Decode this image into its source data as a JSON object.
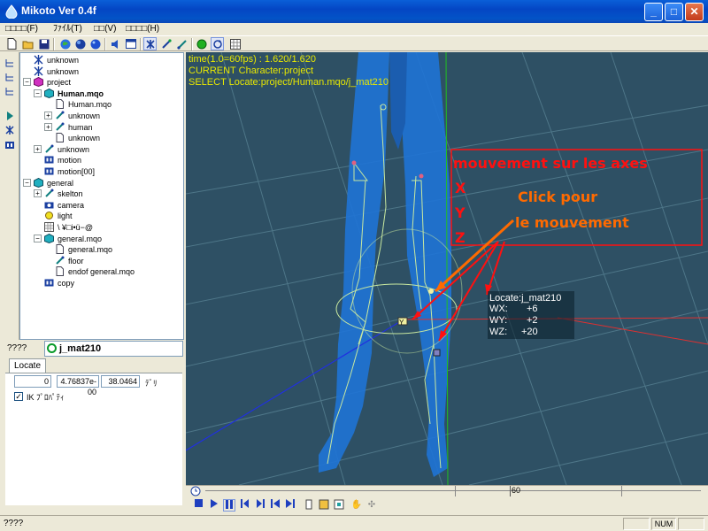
{
  "window": {
    "title": "Mikoto Ver 0.4f",
    "min": "_",
    "max": "□",
    "close": "✕"
  },
  "menu": [
    "□□□□(F)",
    "ﾌｧｲﾙ(T)",
    "□□(V)",
    "□□□□(H)"
  ],
  "toolbar": {
    "icons": [
      "new-file-icon",
      "open-folder-icon",
      "save-icon",
      "globe-icon",
      "globe-dark-icon",
      "sphere-icon",
      "speaker-icon",
      "window-icon",
      "bone-x-icon",
      "bone-blue-icon",
      "bone-teal-icon",
      "green-dot-icon",
      "refresh-icon",
      "grid-icon"
    ]
  },
  "tree": [
    {
      "label": "unknown",
      "icon": "bone-x-icon",
      "depth": 0,
      "expander": ""
    },
    {
      "label": "unknown",
      "icon": "bone-x-icon",
      "depth": 0,
      "expander": ""
    },
    {
      "label": "project",
      "icon": "cube-magenta-icon",
      "depth": 0,
      "expander": "−"
    },
    {
      "label": "Human.mqo",
      "icon": "cube-teal-icon",
      "depth": 1,
      "expander": "−",
      "bold": true
    },
    {
      "label": "Human.mqo",
      "icon": "page-icon",
      "depth": 2,
      "expander": ""
    },
    {
      "label": "unknown",
      "icon": "bone-teal-icon",
      "depth": 2,
      "expander": "+"
    },
    {
      "label": "human",
      "icon": "bone-teal-icon",
      "depth": 2,
      "expander": "+"
    },
    {
      "label": "unknown",
      "icon": "page-icon",
      "depth": 2,
      "expander": ""
    },
    {
      "label": "unknown",
      "icon": "bone-teal-icon",
      "depth": 1,
      "expander": "+"
    },
    {
      "label": "motion",
      "icon": "film-icon",
      "depth": 1,
      "expander": ""
    },
    {
      "label": "motion[00]",
      "icon": "film-icon",
      "depth": 1,
      "expander": ""
    },
    {
      "label": "general",
      "icon": "cube-teal-icon",
      "depth": 0,
      "expander": "−"
    },
    {
      "label": "skelton",
      "icon": "bone-teal-icon",
      "depth": 1,
      "expander": "+"
    },
    {
      "label": "camera",
      "icon": "camera-icon",
      "depth": 1,
      "expander": ""
    },
    {
      "label": "light",
      "icon": "light-icon",
      "depth": 1,
      "expander": ""
    },
    {
      "label": "\\ ¥□i•ü−@",
      "icon": "mesh-icon",
      "depth": 1,
      "expander": ""
    },
    {
      "label": "general.mqo",
      "icon": "cube-teal-icon",
      "depth": 1,
      "expander": "−"
    },
    {
      "label": "general.mqo",
      "icon": "page-icon",
      "depth": 2,
      "expander": ""
    },
    {
      "label": "floor",
      "icon": "bone-teal-icon",
      "depth": 2,
      "expander": ""
    },
    {
      "label": "endof general.mqo",
      "icon": "page-icon",
      "depth": 2,
      "expander": ""
    },
    {
      "label": "copy",
      "icon": "film-icon",
      "depth": 1,
      "expander": ""
    }
  ],
  "props": {
    "title": "????",
    "joint": "j_mat210",
    "tab": "Locate",
    "x": "0",
    "y": "4.76837e-00",
    "z": "38.0464",
    "unit": "ﾃﾞﾘ",
    "ik_checked": "✓",
    "ik_label": "IK ﾌﾟﾛﾊﾟﾃｨ"
  },
  "viewport": {
    "hud": [
      "time(1.0=60fps) : 1.620/1.620",
      "CURRENT Character:project",
      "SELECT Locate:project/Human.mqo/j_mat210"
    ],
    "annotation": {
      "heading": "mouvement sur les axes",
      "axes": [
        "X",
        "Y",
        "Z"
      ],
      "click_line1": "Click pour",
      "click_line2": "le mouvement"
    },
    "joint_info": {
      "name": "Locate:j_mat210",
      "rows": [
        {
          "label": "WX:",
          "value": "+6"
        },
        {
          "label": "WY:",
          "value": "+2"
        },
        {
          "label": "WZ:",
          "value": "+20"
        }
      ]
    },
    "gizmo_label": "Y"
  },
  "timeline": {
    "marker": "60"
  },
  "playback": [
    "stop-icon",
    "play-icon",
    "pause-icon",
    "prev-key-icon",
    "next-key-icon",
    "first-frame-icon",
    "last-frame-icon",
    "loop-icon",
    "page-icon",
    "export-icon",
    "hand-icon",
    "move-icon"
  ],
  "status": {
    "text": "????",
    "num": "NUM"
  },
  "colors": {
    "viewport_bg": "#2e5064",
    "hud_text": "#e8e800",
    "annotation_red": "#ff1010",
    "annotation_orange": "#ff6a00",
    "body_blue": "#1f74d6"
  }
}
